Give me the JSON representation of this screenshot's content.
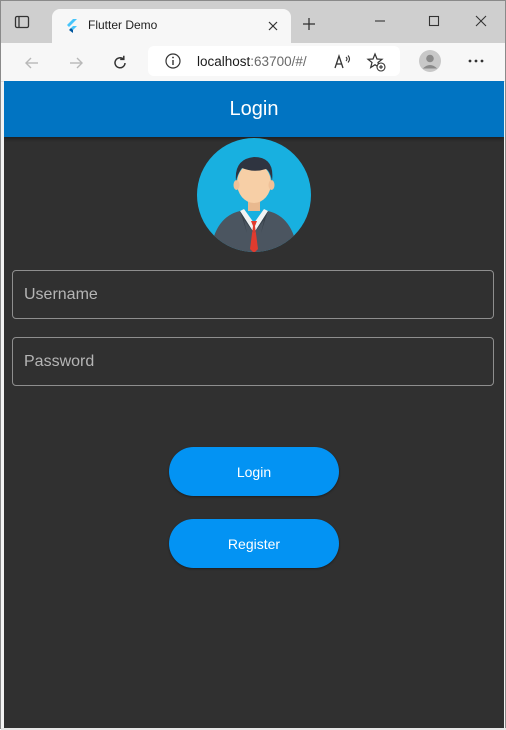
{
  "browser": {
    "tab": {
      "title": "Flutter Demo",
      "favicon": "flutter-logo-icon"
    },
    "address": {
      "host": "localhost",
      "rest": ":63700/#/"
    },
    "icons": {
      "tab_actions": "tab-actions-icon",
      "close_tab": "close-icon",
      "new_tab": "plus-icon",
      "minimize": "minimize-icon",
      "maximize": "maximize-icon",
      "close_window": "close-window-icon",
      "back": "arrow-left-icon",
      "forward": "arrow-right-icon",
      "refresh": "refresh-icon",
      "site_info": "info-icon",
      "read_aloud": "read-aloud-icon",
      "favorites": "star-plus-icon",
      "profile": "profile-avatar-icon",
      "more": "ellipsis-icon"
    }
  },
  "app": {
    "title": "Login",
    "username_placeholder": "Username",
    "password_placeholder": "Password",
    "login_label": "Login",
    "register_label": "Register",
    "colors": {
      "appbar": "#0174c2",
      "background": "#303030",
      "button": "#0393f3"
    }
  }
}
